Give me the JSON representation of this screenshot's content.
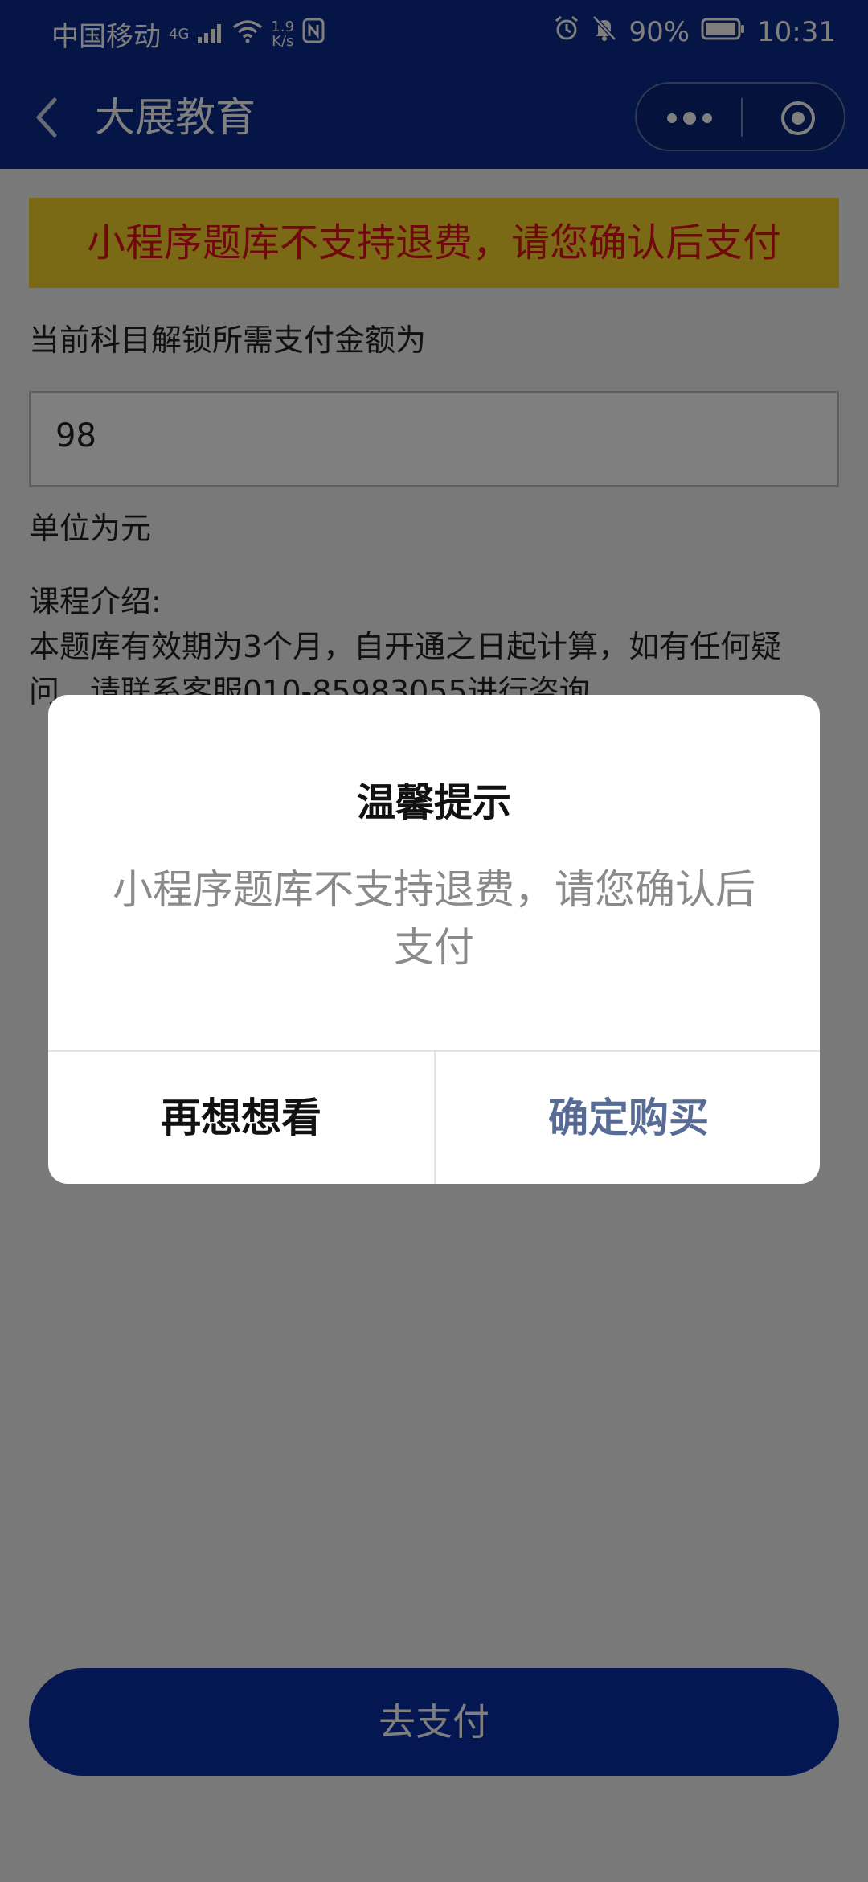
{
  "status_bar": {
    "carrier": "中国移动",
    "network": "4G",
    "speed_value": "1.9",
    "speed_unit": "K/s",
    "battery": "90%",
    "time": "10:31",
    "icons": [
      "signal-icon",
      "wifi-icon",
      "nfc-icon",
      "alarm-icon",
      "bell-off-icon",
      "battery-icon"
    ]
  },
  "nav": {
    "title": "大展教育"
  },
  "content": {
    "warning": "小程序题库不支持退费，请您确认后支付",
    "amount_label": "当前科目解锁所需支付金额为",
    "amount_value": "98",
    "unit_label": "单位为元",
    "course_intro_title": "课程介绍:",
    "course_intro_text": "本题库有效期为3个月，自开通之日起计算，如有任何疑问，请联系客服010-85983055进行咨询"
  },
  "pay_button": {
    "label": "去支付"
  },
  "modal": {
    "title": "温馨提示",
    "message": "小程序题库不支持退费，请您确认后支付",
    "cancel_label": "再想想看",
    "confirm_label": "确定购买"
  },
  "colors": {
    "nav_bg": "#0a2a8a",
    "warning_bg": "#f7d52a",
    "warning_text": "#e3111b",
    "confirm_text": "#576b95",
    "pay_button_bg": "#0a2ea6"
  }
}
